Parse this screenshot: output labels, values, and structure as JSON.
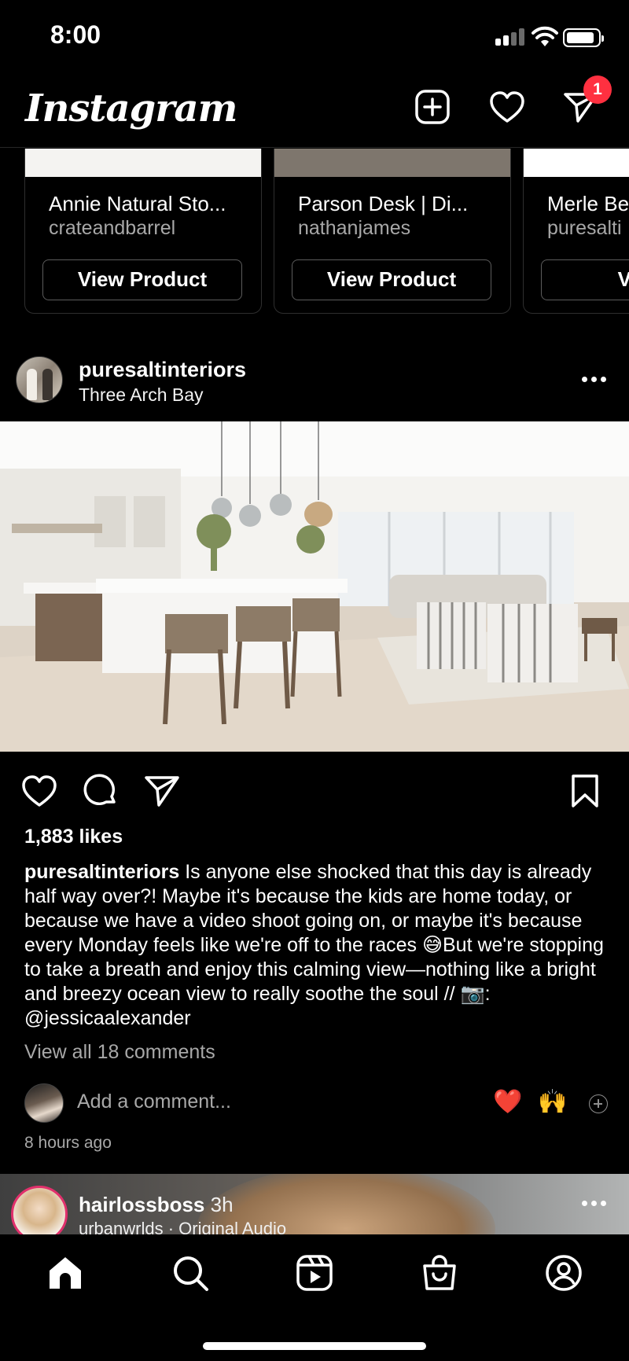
{
  "status_bar": {
    "time": "8:00"
  },
  "header": {
    "logo": "Instagram",
    "notification_count": "1"
  },
  "products": [
    {
      "name": "Annie Natural Sto...",
      "seller": "crateandbarrel",
      "button": "View Product"
    },
    {
      "name": "Parson Desk | Di...",
      "seller": "nathanjames",
      "button": "View Product"
    },
    {
      "name": "Merle Be",
      "seller": "puresalti",
      "button": "View"
    }
  ],
  "post": {
    "username": "puresaltinteriors",
    "location": "Three Arch Bay",
    "likes": "1,883 likes",
    "caption_user": "puresaltinteriors",
    "caption_text": "Is anyone else shocked that this day is already half way over?! Maybe it's because the kids are home today, or because we have a video shoot going on, or maybe it's because every Monday feels like we're off to the races 😅But we're stopping to take a breath and enjoy this calming view—nothing like a bright and breezy ocean view to really soothe the soul // 📷: @jessicaalexander",
    "view_comments": "View all 18 comments",
    "add_comment_placeholder": "Add a comment...",
    "quick_reactions": [
      "❤️",
      "🙌"
    ],
    "timestamp": "8 hours ago"
  },
  "next_post": {
    "username": "hairlossboss",
    "time": "3h",
    "audio": "urbanwrlds · Original Audio"
  },
  "colors": {
    "background": "#000000",
    "badge": "#ff3040",
    "secondary_text": "#a8a8a8",
    "story_ring": "#e1306c"
  },
  "icons": {
    "top_bar": [
      "new-post-icon",
      "heart-icon",
      "direct-message-icon"
    ],
    "post_actions": [
      "like-icon",
      "comment-icon",
      "share-icon",
      "save-icon"
    ],
    "tab_bar": [
      "home-icon",
      "search-icon",
      "reels-icon",
      "shop-icon",
      "profile-icon"
    ]
  }
}
